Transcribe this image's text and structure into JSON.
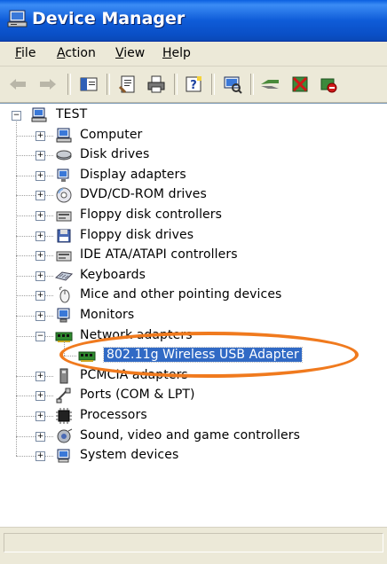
{
  "window": {
    "title": "Device Manager",
    "icon": "computer-manage-icon"
  },
  "menu": [
    {
      "label": "File",
      "accel": "F",
      "rest": "ile"
    },
    {
      "label": "Action",
      "accel": "A",
      "rest": "ction"
    },
    {
      "label": "View",
      "accel": "V",
      "rest": "iew"
    },
    {
      "label": "Help",
      "accel": "H",
      "rest": "elp"
    }
  ],
  "toolbar": [
    {
      "name": "back-icon"
    },
    {
      "name": "forward-icon"
    },
    {
      "name": "show-hide-console-tree-icon"
    },
    {
      "name": "properties-icon"
    },
    {
      "name": "print-icon"
    },
    {
      "name": "help-icon"
    },
    {
      "name": "scan-hardware-icon"
    },
    {
      "name": "update-driver-icon"
    },
    {
      "name": "uninstall-icon"
    },
    {
      "name": "disable-icon"
    }
  ],
  "tree": {
    "root": {
      "label": "TEST",
      "icon": "computer-icon",
      "expanded": true
    },
    "children": [
      {
        "label": "Computer",
        "icon": "computer-icon",
        "expanded": false
      },
      {
        "label": "Disk drives",
        "icon": "disk-drive-icon",
        "expanded": false
      },
      {
        "label": "Display adapters",
        "icon": "display-adapter-icon",
        "expanded": false
      },
      {
        "label": "DVD/CD-ROM drives",
        "icon": "cdrom-icon",
        "expanded": false
      },
      {
        "label": "Floppy disk controllers",
        "icon": "controller-icon",
        "expanded": false
      },
      {
        "label": "Floppy disk drives",
        "icon": "floppy-icon",
        "expanded": false
      },
      {
        "label": "IDE ATA/ATAPI controllers",
        "icon": "controller-icon",
        "expanded": false
      },
      {
        "label": "Keyboards",
        "icon": "keyboard-icon",
        "expanded": false
      },
      {
        "label": "Mice and other pointing devices",
        "icon": "mouse-icon",
        "expanded": false
      },
      {
        "label": "Monitors",
        "icon": "monitor-icon",
        "expanded": false
      },
      {
        "label": "Network adapters",
        "icon": "network-adapter-icon",
        "expanded": true,
        "children": [
          {
            "label": "802.11g Wireless USB Adapter",
            "icon": "network-adapter-icon",
            "selected": true
          }
        ]
      },
      {
        "label": "PCMCIA adapters",
        "icon": "pcmcia-icon",
        "expanded": false
      },
      {
        "label": "Ports (COM & LPT)",
        "icon": "port-icon",
        "expanded": false
      },
      {
        "label": "Processors",
        "icon": "processor-icon",
        "expanded": false
      },
      {
        "label": "Sound, video and game controllers",
        "icon": "sound-icon",
        "expanded": false
      },
      {
        "label": "System devices",
        "icon": "system-device-icon",
        "expanded": false
      }
    ]
  },
  "colors": {
    "titlebar": "#0a5fe0",
    "selection": "#316ac5",
    "highlight_ellipse": "#f07a1e"
  }
}
